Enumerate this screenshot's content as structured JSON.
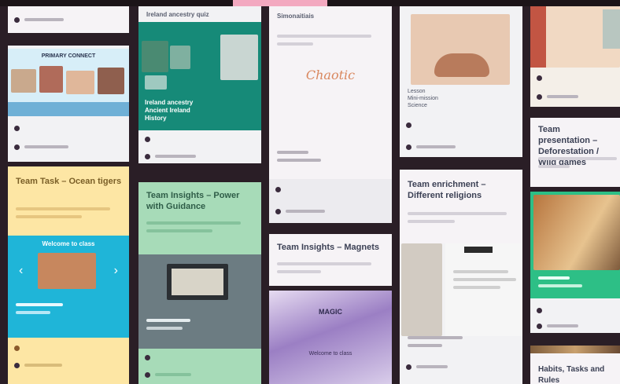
{
  "board": {
    "cards": [
      {
        "id": "c1",
        "banner_title": "PRIMARY CONNECT"
      },
      {
        "id": "c2",
        "header": "Ireland ancestry quiz",
        "caption_lines": [
          "Ireland ancestry",
          "Ancient Ireland",
          "History"
        ]
      },
      {
        "id": "c3",
        "header": "Simonaitiais",
        "logo_text": "Chaotic"
      },
      {
        "id": "c4",
        "caption_lines": [
          "Lesson",
          "Mini-mission",
          "Science"
        ]
      },
      {
        "id": "c5",
        "title": "Team Task – Ocean tigers"
      },
      {
        "id": "c6",
        "title": "Team Insights – Power with Guidance"
      },
      {
        "id": "c7",
        "title": "Team Insights – Magnets"
      },
      {
        "id": "c8",
        "title": "Team presentation – Deforestation / Wild games"
      },
      {
        "id": "c9",
        "title": "Team enrichment – Different religions"
      },
      {
        "id": "c10",
        "title": "Habits, Tasks and Rules"
      },
      {
        "id": "c11",
        "banner_title": "Welcome to class"
      },
      {
        "id": "c12",
        "banner_title": "MAGIC",
        "subtitle_lines": [
          "Welcome to class"
        ]
      }
    ]
  },
  "colors": {
    "teal": "#168a78",
    "mint": "#a7dbb8",
    "yellow": "#fde6a4",
    "cyan": "#1fb5d8",
    "slate": "#6c7c82",
    "purple": "#9b7fc4",
    "green": "#2dbf86",
    "cream": "#f4f1ec"
  }
}
